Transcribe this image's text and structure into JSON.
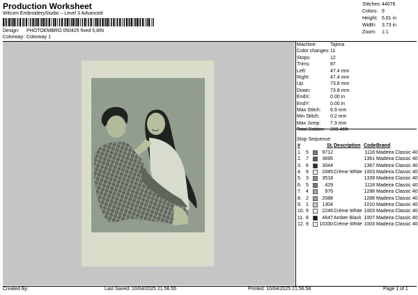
{
  "header": {
    "title": "Production Worksheet",
    "subtitle": "Wilcom EmbroideryStudio – Level 3 Advanced",
    "design_label": "Design:",
    "design_value": "PHOTOEMBRO 050425 fixed 5,8IN",
    "colorway_label": "Colorway:",
    "colorway_value": "Colorway 1"
  },
  "stats": [
    {
      "label": "Stitches:",
      "value": "44076"
    },
    {
      "label": "Colors:",
      "value": "9"
    },
    {
      "label": "Height:",
      "value": "5.81 in"
    },
    {
      "label": "Width:",
      "value": "3.73 in"
    },
    {
      "label": "Zoom:",
      "value": "1:1"
    }
  ],
  "machine_info": [
    {
      "label": "Machine:",
      "value": "Tajima"
    },
    {
      "label": "Color changes:",
      "value": "11"
    },
    {
      "label": "Stops:",
      "value": "12"
    },
    {
      "label": "Trims:",
      "value": "87"
    },
    {
      "label": "Left:",
      "value": "47.4 mm"
    },
    {
      "label": "Right:",
      "value": "47.4 mm"
    },
    {
      "label": "Up:",
      "value": "73.8 mm"
    },
    {
      "label": "Down:",
      "value": "73.8 mm"
    },
    {
      "label": "EndX:",
      "value": "0.00 in"
    },
    {
      "label": "EndY:",
      "value": "0.00 in"
    },
    {
      "label": "Max Stitch:",
      "value": "6.9 mm"
    },
    {
      "label": "Min Stitch:",
      "value": "0.2 mm"
    },
    {
      "label": "Max Jump:",
      "value": "7.3 mm"
    },
    {
      "label": "Total Bobbin:",
      "value": "288.46ft"
    }
  ],
  "stop_sequence": {
    "title": "Stop Sequence:",
    "headers": {
      "num": "#",
      "st": "St.",
      "desc": "Description",
      "code": "Code",
      "brand": "Brand"
    },
    "rows": [
      {
        "num": "1.",
        "color": "5",
        "swatch": "#7a7a7a",
        "st": "9712",
        "desc": "",
        "code": "1118",
        "brand": "Madeira Classic 40"
      },
      {
        "num": "2.",
        "color": "7",
        "swatch": "#5a5a5a",
        "st": "3695",
        "desc": "",
        "code": "1361",
        "brand": "Madeira Classic 40"
      },
      {
        "num": "3.",
        "color": "6",
        "swatch": "#2c2c2c",
        "st": "3044",
        "desc": "",
        "code": "1367",
        "brand": "Madeira Classic 40"
      },
      {
        "num": "4.",
        "color": "9",
        "swatch": "#f2f2ea",
        "st": "2085",
        "desc": "Crème White",
        "code": "1003",
        "brand": "Madeira Classic 40"
      },
      {
        "num": "5.",
        "color": "3",
        "swatch": "#8c8c8c",
        "st": "3518",
        "desc": "",
        "code": "1339",
        "brand": "Madeira Classic 40"
      },
      {
        "num": "6.",
        "color": "5",
        "swatch": "#7a7a7a",
        "st": "429",
        "desc": "",
        "code": "1118",
        "brand": "Madeira Classic 40"
      },
      {
        "num": "7.",
        "color": "4",
        "swatch": "#a4a4a4",
        "st": "976",
        "desc": "",
        "code": "1288",
        "brand": "Madeira Classic 40"
      },
      {
        "num": "8.",
        "color": "2",
        "swatch": "#9a9a9a",
        "st": "2088",
        "desc": "",
        "code": "1288",
        "brand": "Madeira Classic 40"
      },
      {
        "num": "9.",
        "color": "1",
        "swatch": "#c8c8c8",
        "st": "1304",
        "desc": "",
        "code": "1010",
        "brand": "Madeira Classic 40"
      },
      {
        "num": "10.",
        "color": "9",
        "swatch": "#f2f2ea",
        "st": "2246",
        "desc": "Crème White",
        "code": "1003",
        "brand": "Madeira Classic 40"
      },
      {
        "num": "11.",
        "color": "8",
        "swatch": "#1a1a1a",
        "st": "4647",
        "desc": "Amber Black",
        "code": "1007",
        "brand": "Madeira Classic 40"
      },
      {
        "num": "12.",
        "color": "9",
        "swatch": "#f2f2ea",
        "st": "10330",
        "desc": "Crème White",
        "code": "1003",
        "brand": "Madeira Classic 40"
      }
    ]
  },
  "footer": {
    "created_by": "Created By:",
    "last_saved": "Last Saved: 10/04/2025 21.56.55",
    "printed": "Printed: 10/04/2025 21.56.58",
    "page": "Page 1 of 1"
  },
  "colors": {
    "canvas_bg": "#c5c5c5",
    "frame": "#d8dcc8",
    "photo_bg": "#8e9a8c",
    "skin": "#b8bf9f",
    "hair": "#1f2320"
  }
}
